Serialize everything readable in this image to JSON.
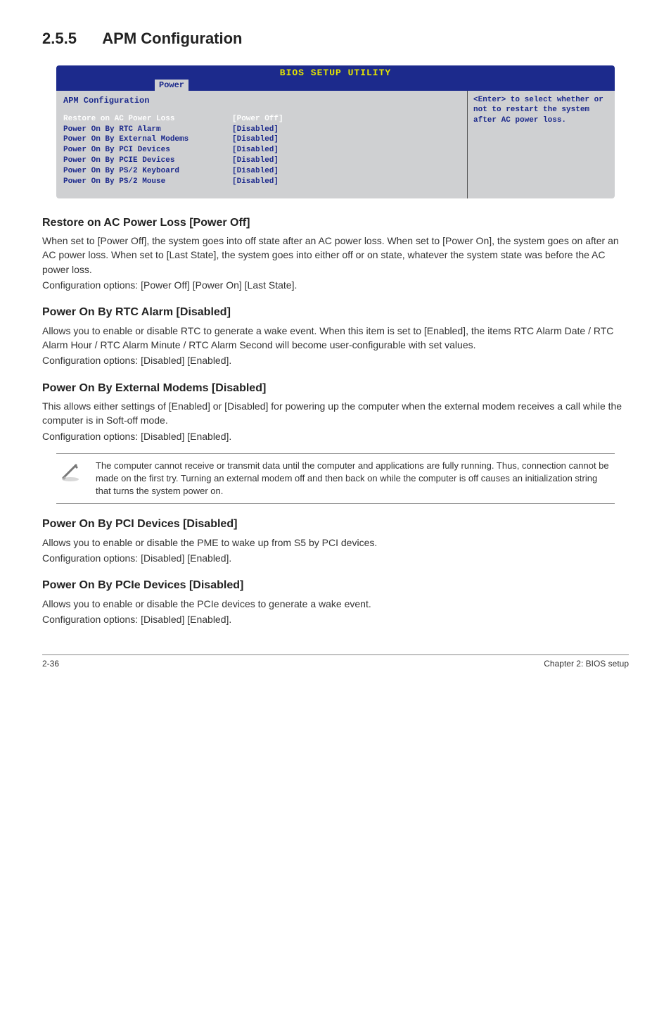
{
  "section": {
    "number": "2.5.5",
    "title": "APM Configuration"
  },
  "bios": {
    "utility_title": "BIOS SETUP UTILITY",
    "tab": "Power",
    "panel_title": "APM Configuration",
    "help": "<Enter> to select whether or not to restart the system after AC power loss.",
    "rows": [
      {
        "label": "Restore on AC Power Loss",
        "value": "[Power Off]",
        "selected": true
      },
      {
        "label": "Power On By RTC Alarm",
        "value": "[Disabled]",
        "selected": false
      },
      {
        "label": "Power On By External Modems",
        "value": "[Disabled]",
        "selected": false
      },
      {
        "label": "Power On By PCI Devices",
        "value": "[Disabled]",
        "selected": false
      },
      {
        "label": "Power On By PCIE Devices",
        "value": "[Disabled]",
        "selected": false
      },
      {
        "label": "Power On By PS/2 Keyboard",
        "value": "[Disabled]",
        "selected": false
      },
      {
        "label": "Power On By PS/2 Mouse",
        "value": "[Disabled]",
        "selected": false
      }
    ]
  },
  "s1": {
    "h": "Restore on AC Power Loss [Power Off]",
    "p1": "When set to [Power Off], the system goes into off state after an AC power loss. When set to [Power On], the system goes on after an AC power loss. When set to [Last State], the system goes into either off or on state, whatever the system state was before the AC power loss.",
    "p2": "Configuration options: [Power Off] [Power On] [Last State]."
  },
  "s2": {
    "h": "Power On By RTC Alarm [Disabled]",
    "p1": "Allows you to enable or disable RTC to generate a wake event. When this item is set to [Enabled], the items RTC Alarm Date / RTC Alarm Hour / RTC Alarm Minute / RTC Alarm Second will become user-configurable with set values.",
    "p2": "Configuration options: [Disabled] [Enabled]."
  },
  "s3": {
    "h": "Power On By External Modems [Disabled]",
    "p1": "This allows either settings of [Enabled] or [Disabled] for powering up the computer when the external modem receives a call while the computer is in Soft-off mode.",
    "p2": "Configuration options: [Disabled] [Enabled]."
  },
  "note": "The computer cannot receive or transmit data until the computer and applications are fully running. Thus, connection cannot be made on the first try. Turning an external modem off and then back on while the computer is off causes an initialization string that turns the system power on.",
  "s4": {
    "h": "Power On By PCI Devices [Disabled]",
    "p1": "Allows you to enable or disable the PME to wake up from S5 by PCI devices.",
    "p2": "Configuration options: [Disabled] [Enabled]."
  },
  "s5": {
    "h": "Power On By PCIe Devices [Disabled]",
    "p1": "Allows you to enable or disable the PCIe devices to generate a wake event.",
    "p2": "Configuration options: [Disabled] [Enabled]."
  },
  "footer": {
    "left": "2-36",
    "right": "Chapter 2: BIOS setup"
  }
}
